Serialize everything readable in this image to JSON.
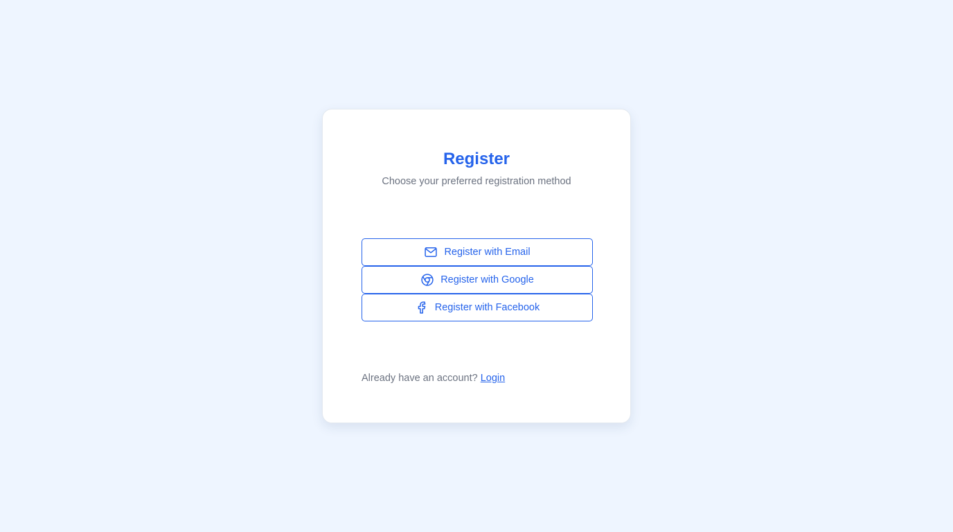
{
  "page": {
    "title": "Register",
    "subtitle": "Choose your preferred registration method"
  },
  "buttons": [
    {
      "label": "Register with Email",
      "icon": "mail-icon"
    },
    {
      "label": "Register with Google",
      "icon": "chrome-icon"
    },
    {
      "label": "Register with Facebook",
      "icon": "facebook-icon"
    }
  ],
  "footer": {
    "prompt": "Already have an account?",
    "link_label": "Login"
  },
  "colors": {
    "accent": "#2563eb",
    "background": "#eef5ff",
    "muted_text": "#6b7280"
  }
}
